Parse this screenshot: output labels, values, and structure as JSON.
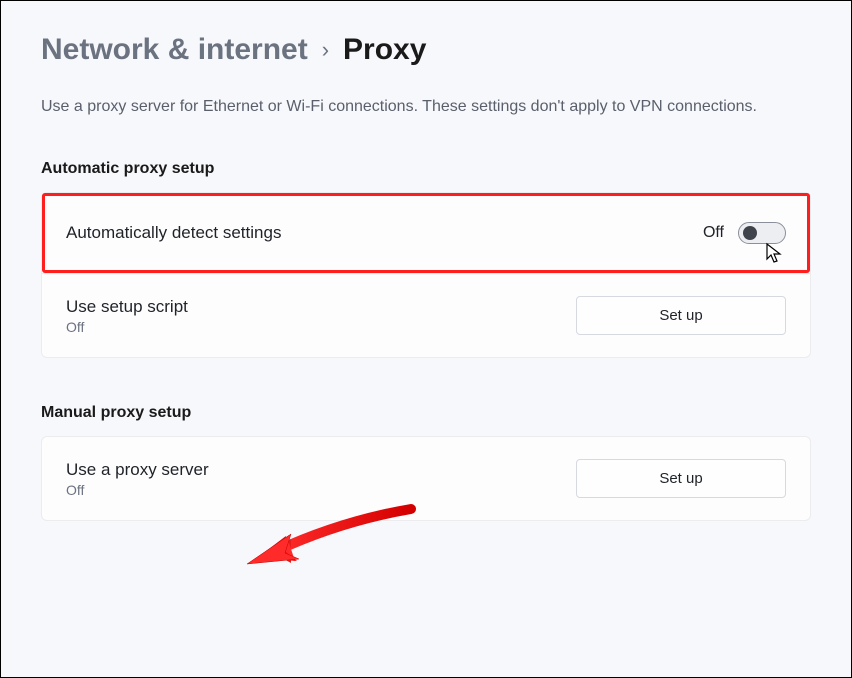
{
  "breadcrumb": {
    "parent": "Network & internet",
    "current": "Proxy"
  },
  "description": "Use a proxy server for Ethernet or Wi-Fi connections. These settings don't apply to VPN connections.",
  "sections": {
    "automatic": {
      "heading": "Automatic proxy setup",
      "detect": {
        "label": "Automatically detect settings",
        "state_label": "Off"
      },
      "script": {
        "label": "Use setup script",
        "status": "Off",
        "button": "Set up"
      }
    },
    "manual": {
      "heading": "Manual proxy setup",
      "server": {
        "label": "Use a proxy server",
        "status": "Off",
        "button": "Set up"
      }
    }
  }
}
